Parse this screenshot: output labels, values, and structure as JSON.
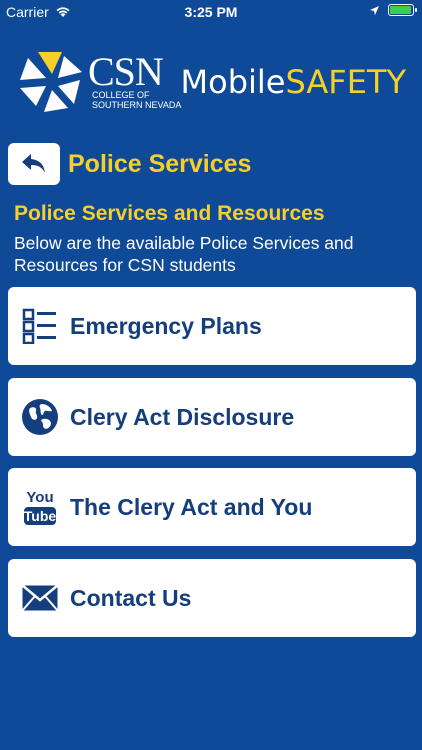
{
  "status_bar": {
    "carrier": "Carrier",
    "time": "3:25 PM"
  },
  "header": {
    "logo_name": "CSN",
    "logo_subtitle_line1": "COLLEGE OF",
    "logo_subtitle_line2": "SOUTHERN NEVADA",
    "app_name_part1": "Mobile",
    "app_name_part2": "SAFETY"
  },
  "nav": {
    "page_title": "Police Services"
  },
  "section": {
    "heading": "Police Services and Resources",
    "description": "Below are the available Police Services and Resources for CSN students"
  },
  "menu": [
    {
      "label": "Emergency Plans",
      "icon": "list-icon"
    },
    {
      "label": "Clery Act Disclosure",
      "icon": "globe-icon"
    },
    {
      "label": "The Clery Act and You",
      "icon": "youtube-icon"
    },
    {
      "label": "Contact Us",
      "icon": "envelope-icon"
    }
  ],
  "colors": {
    "background": "#0f4a98",
    "accent": "#f5cf2a",
    "card_text": "#153e7c"
  }
}
